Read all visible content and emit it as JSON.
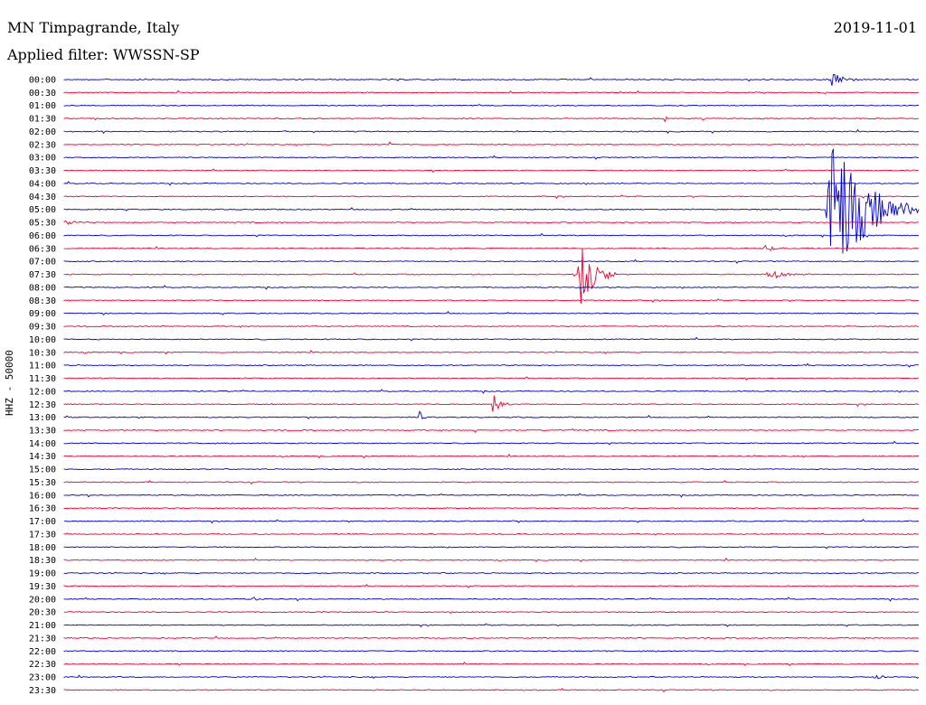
{
  "header": {
    "station": "MN Timpagrande, Italy",
    "date": "2019-11-01",
    "filter": "Applied filter: WWSSN-SP"
  },
  "chart_data": {
    "type": "line",
    "title": "MN Timpagrande, Italy",
    "date": "2019-11-01",
    "ylabel": "HHZ - 50000",
    "row_labels": [
      "00:00",
      "00:30",
      "01:00",
      "01:30",
      "02:00",
      "02:30",
      "03:00",
      "03:30",
      "04:00",
      "04:30",
      "05:00",
      "05:30",
      "06:00",
      "06:30",
      "07:00",
      "07:30",
      "08:00",
      "08:30",
      "09:00",
      "09:30",
      "10:00",
      "10:30",
      "11:00",
      "11:30",
      "12:00",
      "12:30",
      "13:00",
      "13:30",
      "14:00",
      "14:30",
      "15:00",
      "15:30",
      "16:00",
      "16:30",
      "17:00",
      "17:30",
      "18:00",
      "18:30",
      "19:00",
      "19:30",
      "20:00",
      "20:30",
      "21:00",
      "21:30",
      "22:00",
      "22:30",
      "23:00",
      "23:30"
    ],
    "colors": [
      "#0000cc",
      "#ee0033"
    ],
    "grid": false,
    "events": [
      {
        "row": "00:00",
        "x": 0.895,
        "amp": 8,
        "dur": 0.04
      },
      {
        "row": "01:30",
        "x": 0.7,
        "amp": 6,
        "dur": 0.01
      },
      {
        "row": "02:30",
        "x": 0.38,
        "amp": 4,
        "dur": 0.01
      },
      {
        "row": "05:00",
        "x": 0.89,
        "amp": 90,
        "dur": 0.11
      },
      {
        "row": "05:30",
        "x": 0.0,
        "amp": 3,
        "dur": 0.03
      },
      {
        "row": "06:30",
        "x": 0.815,
        "amp": 4,
        "dur": 0.04
      },
      {
        "row": "07:30",
        "x": 0.6,
        "amp": 45,
        "dur": 0.045
      },
      {
        "row": "07:30",
        "x": 0.82,
        "amp": 6,
        "dur": 0.06
      },
      {
        "row": "12:30",
        "x": 0.5,
        "amp": 14,
        "dur": 0.03
      },
      {
        "row": "13:00",
        "x": 0.415,
        "amp": 7,
        "dur": 0.01
      },
      {
        "row": "13:30",
        "x": 0.48,
        "amp": 8,
        "dur": 0.005
      },
      {
        "row": "20:00",
        "x": 0.22,
        "amp": 3,
        "dur": 0.02
      },
      {
        "row": "23:00",
        "x": 0.945,
        "amp": 3,
        "dur": 0.03
      }
    ]
  }
}
